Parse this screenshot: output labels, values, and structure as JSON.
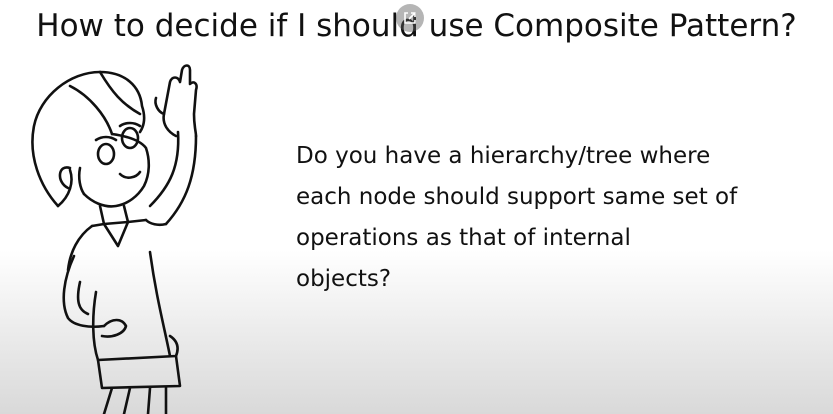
{
  "slide": {
    "title": "How to decide if I should use Composite Pattern?",
    "lines": [
      "Do you have a hierarchy/tree where",
      "each node should support same set of",
      "operations as that of internal",
      "objects?"
    ]
  },
  "icons": {
    "popout": "external-link-icon",
    "illustration": "girl-raising-hand-illustration"
  }
}
